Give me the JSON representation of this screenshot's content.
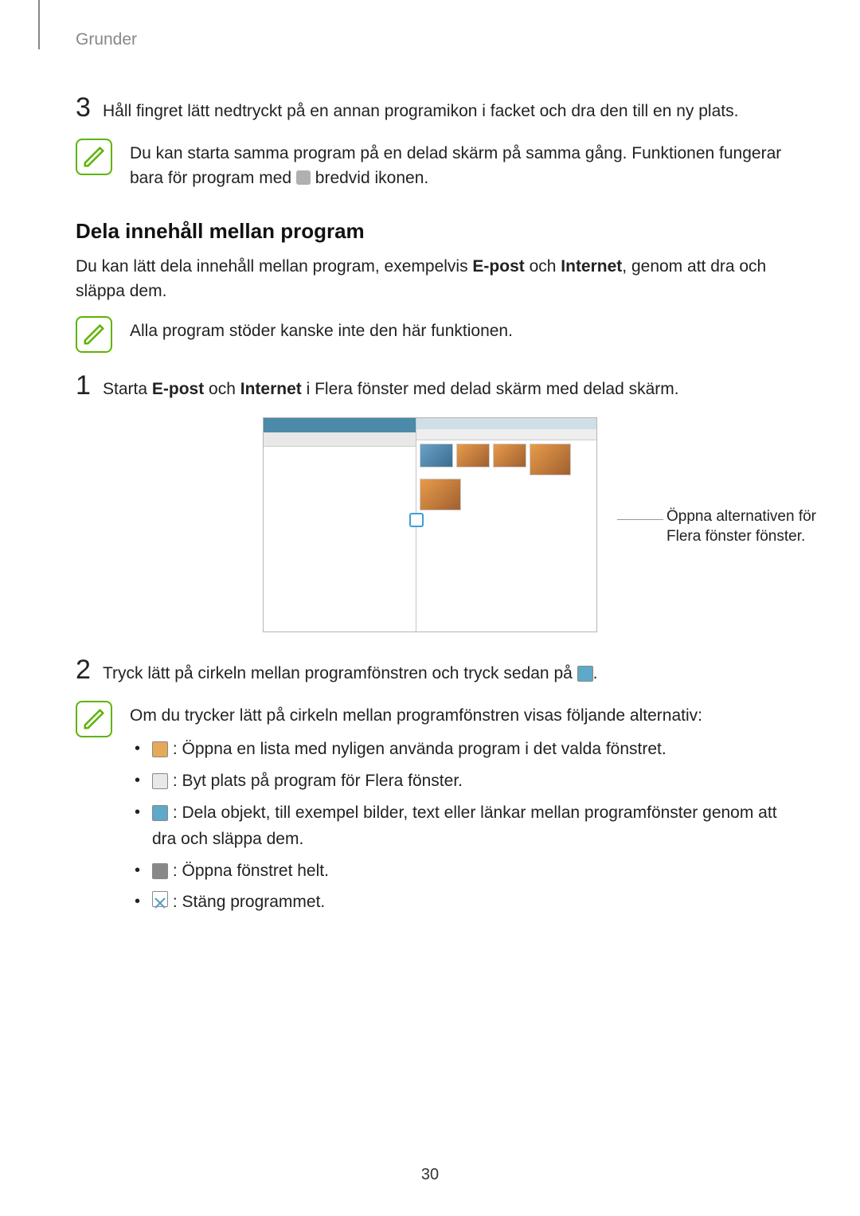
{
  "header": {
    "section": "Grunder"
  },
  "step3": {
    "num": "3",
    "text": "Håll fingret lätt nedtryckt på en annan programikon i facket och dra den till en ny plats."
  },
  "note1": {
    "pre": "Du kan starta samma program på en delad skärm på samma gång. Funktionen fungerar bara för program med ",
    "post": " bredvid ikonen."
  },
  "heading2": "Dela innehåll mellan program",
  "intro": {
    "pre": "Du kan lätt dela innehåll mellan program, exempelvis ",
    "b1": "E-post",
    "mid": " och ",
    "b2": "Internet",
    "post": ", genom att dra och släppa dem."
  },
  "note2": {
    "text": "Alla program stöder kanske inte den här funktionen."
  },
  "step1": {
    "num": "1",
    "pre": "Starta ",
    "b1": "E-post",
    "mid": " och ",
    "b2": "Internet",
    "post": " i Flera fönster med delad skärm med delad skärm."
  },
  "callout": "Öppna alternativen för Flera fönster fönster.",
  "step2": {
    "num": "2",
    "pre": "Tryck lätt på cirkeln mellan programfönstren och tryck sedan på ",
    "post": "."
  },
  "note3": {
    "lead": "Om du trycker lätt på cirkeln mellan programfönstren visas följande alternativ:",
    "items": {
      "recent": " : Öppna en lista med nyligen använda program i det valda fönstret.",
      "swap": " : Byt plats på program för Flera fönster.",
      "drag": " : Dela objekt, till exempel bilder, text eller länkar mellan programfönster genom att dra och släppa dem.",
      "max": " : Öppna fönstret helt.",
      "close": " : Stäng programmet."
    }
  },
  "page_number": "30"
}
